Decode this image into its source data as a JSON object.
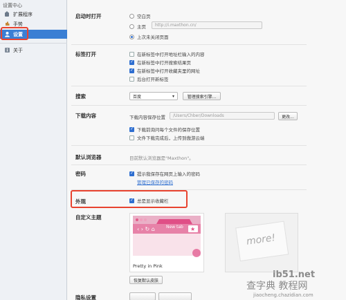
{
  "sidebar": {
    "title": "设置中心",
    "items": [
      {
        "label": "扩展程序",
        "icon": "puzzle-icon"
      },
      {
        "label": "手势",
        "icon": "gesture-icon"
      },
      {
        "label": "设置",
        "icon": "user-icon",
        "active": true
      },
      {
        "label": "关于",
        "icon": "about-icon"
      }
    ]
  },
  "startup": {
    "label": "启动时打开",
    "options": [
      "空白页",
      "主页",
      "上次未关闭页面"
    ],
    "selected_index": 2,
    "homepage_value": "http://i.maxthon.cn/"
  },
  "tabs": {
    "label": "标签打开",
    "options": [
      {
        "label": "在新标签中打开地址栏输入的内容",
        "checked": false
      },
      {
        "label": "在新标签中打开搜索结果页",
        "checked": true
      },
      {
        "label": "在新标签中打开收藏夹里的网址",
        "checked": true
      },
      {
        "label": "后台打开新标签",
        "checked": false
      }
    ]
  },
  "search": {
    "label": "搜索",
    "engine": "百度",
    "manage_button": "管理搜索引擎..."
  },
  "download": {
    "label": "下载内容",
    "location_label": "下载内容保存位置",
    "location_value": "/Users/Chber/Downloads",
    "change_button": "更改...",
    "options": [
      {
        "label": "下载前询问每个文件的保存位置",
        "checked": true
      },
      {
        "label": "文件下载完成后，上传到傲游云端",
        "checked": false
      }
    ]
  },
  "default_browser": {
    "label": "默认浏览器",
    "text": "目前默认浏览器是\"Maxthon\"。"
  },
  "password": {
    "label": "密码",
    "option": {
      "label": "提示我保存在网页上输入的密码",
      "checked": true
    },
    "link": "管理已保存的密码"
  },
  "appearance": {
    "label": "外观",
    "option": {
      "label": "总是显示收藏栏",
      "checked": true
    }
  },
  "custom_theme": {
    "label": "自定义主题",
    "themes": [
      {
        "name": "Pretty in Pink",
        "preview_tab": "New tab"
      },
      {
        "name": "",
        "preview_text": "more!"
      }
    ],
    "restore_button": "恢复默认皮肤"
  },
  "privacy": {
    "label": "隐私设置",
    "buttons": [
      "",
      ""
    ]
  },
  "watermark": {
    "brand": "ib51.net",
    "cn": "查字典 教程网",
    "url": "jiaocheng.chazidian.com"
  },
  "colors": {
    "accent": "#3b7fd4",
    "highlight": "#e8432f",
    "theme_pink": "#e04f86"
  }
}
